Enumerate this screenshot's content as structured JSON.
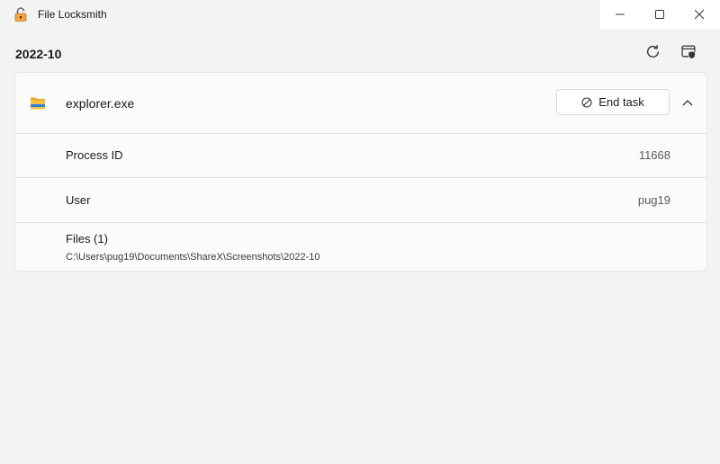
{
  "window": {
    "title": "File Locksmith",
    "controls": {
      "minimize": "minimize-icon",
      "maximize": "maximize-icon",
      "close": "close-icon"
    }
  },
  "header": {
    "folder_name": "2022-10",
    "refresh_icon": "refresh-icon",
    "admin_icon": "run-as-admin-icon"
  },
  "process": {
    "name": "explorer.exe",
    "icon": "folder-icon",
    "end_task_label": "End task",
    "expanded": true,
    "details": [
      {
        "label": "Process ID",
        "value": "11668"
      },
      {
        "label": "User",
        "value": "pug19"
      }
    ],
    "files_label": "Files (1)",
    "files": [
      "C:\\Users\\pug19\\Documents\\ShareX\\Screenshots\\2022-10"
    ]
  },
  "colors": {
    "background": "#f3f3f3",
    "card": "#fbfbfb",
    "folder_yellow": "#f6c343",
    "folder_blue": "#2b7de0"
  }
}
